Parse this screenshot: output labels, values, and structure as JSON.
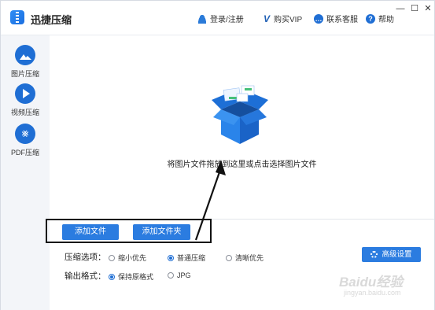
{
  "window": {
    "title": "迅捷压缩",
    "controls": {
      "minimize": "—",
      "maximize": "☐",
      "close": "✕"
    }
  },
  "header": {
    "login": "登录/注册",
    "buy_vip": "购买VIP",
    "support": "联系客服",
    "help": "帮助",
    "icons": [
      "user-icon",
      "vip-icon",
      "chat-icon",
      "help-icon"
    ]
  },
  "sidebar": {
    "items": [
      {
        "label": "图片压缩",
        "icon": "image-icon"
      },
      {
        "label": "视频压缩",
        "icon": "play-icon"
      },
      {
        "label": "PDF压缩",
        "icon": "pdf-icon"
      }
    ]
  },
  "drop_zone": {
    "instruction": "将图片文件拖放到这里或点击选择图片文件",
    "icon": "open-box-icon"
  },
  "actions": {
    "add_file": "添加文件",
    "add_folder": "添加文件夹"
  },
  "options": {
    "compress_label": "压缩选项：",
    "compress_options": [
      "缩小优先",
      "普通压缩",
      "清晰优先"
    ],
    "compress_selected": "普通压缩",
    "format_label": "输出格式：",
    "format_options": [
      "保持原格式",
      "JPG"
    ],
    "format_selected": "保持原格式",
    "advanced": "高级设置"
  },
  "watermark": {
    "text": "Baidu经验",
    "sub": "jingyan.baidu.com"
  },
  "colors": {
    "accent": "#2b7ce0",
    "sidebar_bg": "#f3f5f9",
    "annotation": "#111111"
  }
}
